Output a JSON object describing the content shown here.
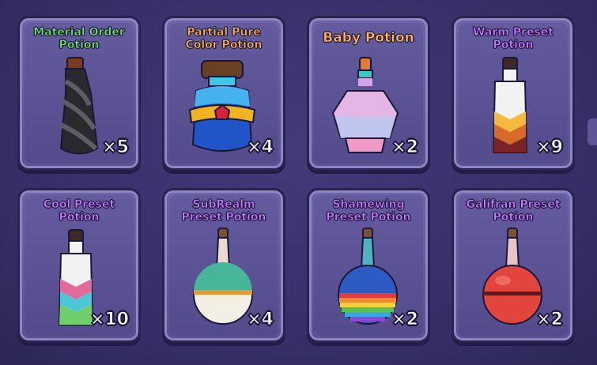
{
  "inventory": {
    "items": [
      {
        "name": "Material Order\nPotion",
        "count": "×5",
        "title_color": "#6fe36b",
        "icon": "twisted-black-bottle-icon"
      },
      {
        "name": "Partial Pure\nColor Potion",
        "count": "×4",
        "title_color": "#ffb14a",
        "icon": "blue-gold-jar-icon"
      },
      {
        "name": "Baby Potion",
        "count": "×2",
        "title_color": "#ffb65a",
        "icon": "pastel-flask-icon"
      },
      {
        "name": "Warm Preset\nPotion",
        "count": "×9",
        "title_color": "#c77bff",
        "icon": "warm-striped-bottle-icon"
      },
      {
        "name": "Cool Preset\nPotion",
        "count": "×10",
        "title_color": "#c77bff",
        "icon": "cool-striped-bottle-icon"
      },
      {
        "name": "SubRealm\nPreset Potion",
        "count": "×4",
        "title_color": "#c77bff",
        "icon": "subrealm-round-flask-icon"
      },
      {
        "name": "Shamewing\nPreset Potion",
        "count": "×2",
        "title_color": "#c77bff",
        "icon": "rainbow-round-flask-icon"
      },
      {
        "name": "Galifran Preset\nPotion",
        "count": "×2",
        "title_color": "#c77bff",
        "icon": "red-round-flask-icon"
      }
    ]
  }
}
